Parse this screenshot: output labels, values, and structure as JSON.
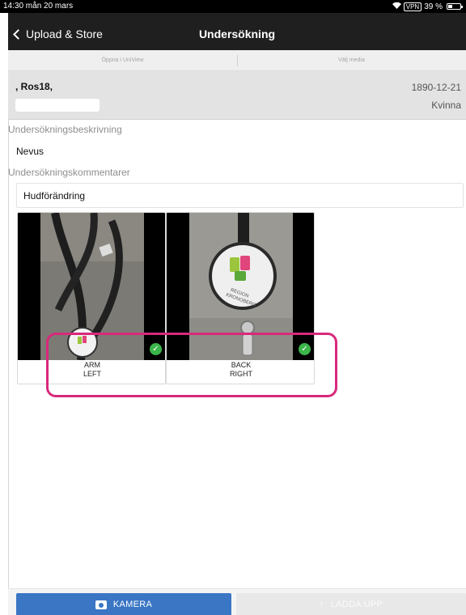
{
  "status_bar": {
    "time_date": "14:30  mån 20 mars",
    "vpn": "VPN",
    "battery_percent": "39 %",
    "battery_level": 0.39
  },
  "nav": {
    "back_label": "Upload & Store",
    "title": "Undersökning"
  },
  "actions": {
    "open_uniview": "Öppna i UniView",
    "choose_media": "Välj media"
  },
  "patient": {
    "name": ", Ros18,",
    "birth_date": "1890-12-21",
    "sex": "Kvinna"
  },
  "exam": {
    "description_label": "Undersökningsbeskrivning",
    "description_value": "Nevus",
    "comments_label": "Undersökningskommentarer",
    "comments_value": "Hudförändring"
  },
  "images": [
    {
      "line1": "ARM",
      "line2": "LEFT",
      "selected": true
    },
    {
      "line1": "BACK",
      "line2": "RIGHT",
      "selected": true
    }
  ],
  "buttons": {
    "camera": "KAMERA",
    "upload": "LADDA UPP"
  },
  "colors": {
    "accent_blue": "#3a76c4",
    "check_green": "#3cb54a",
    "highlight_pink": "#d8297b",
    "navbar": "#1f1f1f"
  }
}
